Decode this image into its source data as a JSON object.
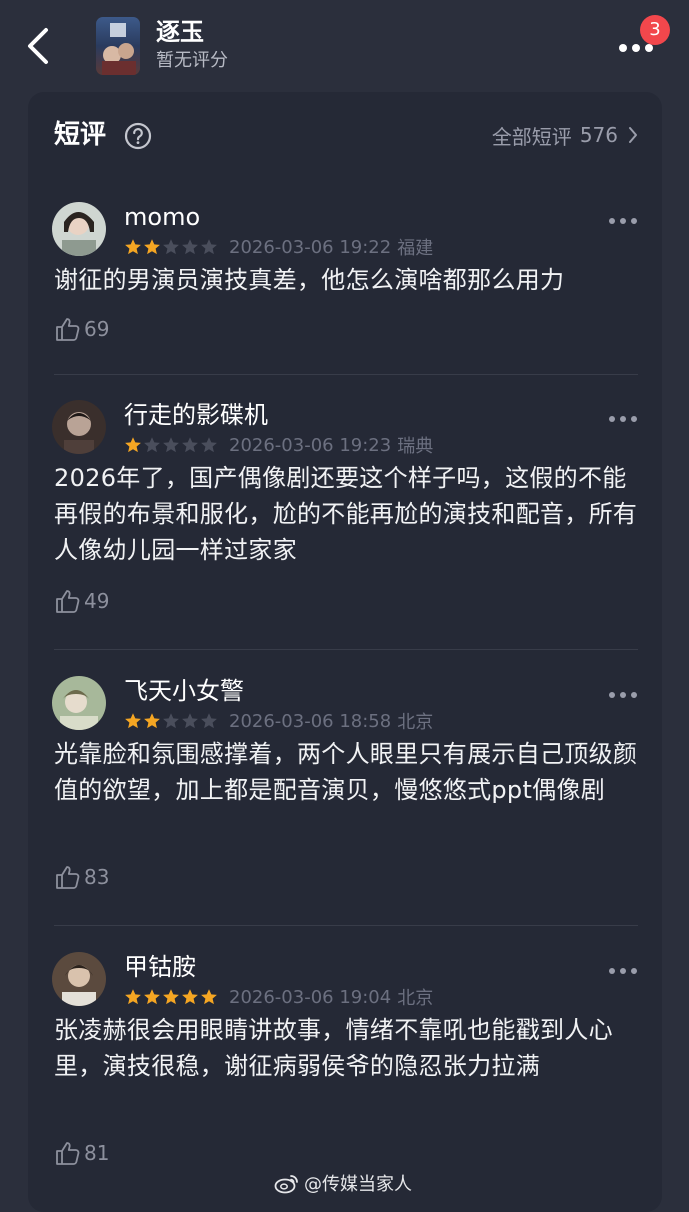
{
  "header": {
    "title": "逐玉",
    "subtitle": "暂无评分",
    "notification_count": "3",
    "back_icon": "chevron-left-icon",
    "more_icon": "more-horizontal-icon"
  },
  "section": {
    "title": "短评",
    "help_icon": "question-circle-icon",
    "all_label": "全部短评",
    "all_count": "576"
  },
  "colors": {
    "star_active": "#f5a623",
    "star_inactive": "#4a4e5c",
    "badge": "#f2474c",
    "background": "#2b2f3c",
    "card": "#252936"
  },
  "reviews": [
    {
      "username": "momo",
      "rating": 2,
      "rating_max": 5,
      "date": "2026-03-06 19:22",
      "location": "福建",
      "text": "谢征的男演员演技真差，他怎么演啥都那么用力",
      "likes": "69"
    },
    {
      "username": "行走的影碟机",
      "rating": 1,
      "rating_max": 5,
      "date": "2026-03-06 19:23",
      "location": "瑞典",
      "text": "2026年了，国产偶像剧还要这个样子吗，这假的不能再假的布景和服化，尬的不能再尬的演技和配音，所有人像幼儿园一样过家家",
      "likes": "49"
    },
    {
      "username": "飞天小女警",
      "rating": 2,
      "rating_max": 5,
      "date": "2026-03-06 18:58",
      "location": "北京",
      "text": "光靠脸和氛围感撑着，两个人眼里只有展示自己顶级颜值的欲望，加上都是配音演贝，慢悠悠式ppt偶像剧",
      "likes": "83"
    },
    {
      "username": "甲钴胺",
      "rating": 5,
      "rating_max": 5,
      "date": "2026-03-06 19:04",
      "location": "北京",
      "text": "张凌赫很会用眼睛讲故事，情绪不靠吼也能戳到人心里，演技很稳，谢征病弱侯爷的隐忍张力拉满",
      "likes": "81"
    }
  ],
  "watermark": {
    "text": "@传媒当家人",
    "icon": "weibo-icon"
  }
}
